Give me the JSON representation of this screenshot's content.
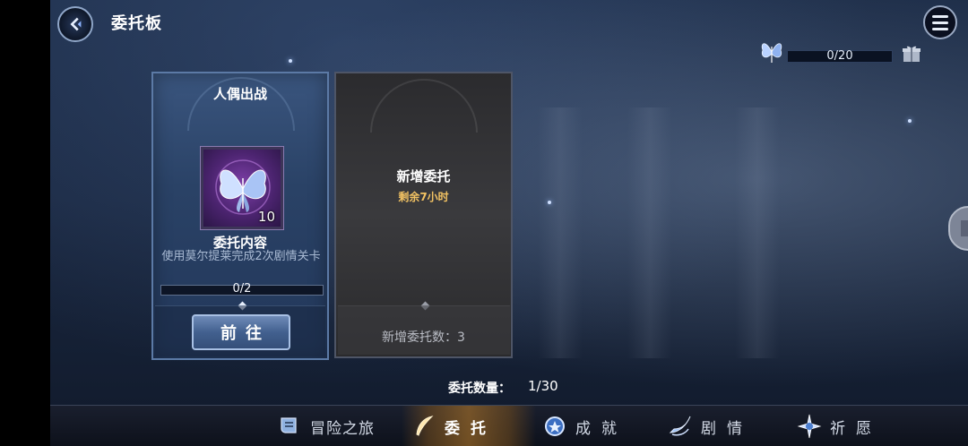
{
  "header": {
    "title": "委托板"
  },
  "topbar": {
    "progress_text": "0/20"
  },
  "cards": [
    {
      "title": "人偶出战",
      "reward_count": "10",
      "content_label": "委托内容",
      "description": "使用莫尔提莱完成2次剧情关卡",
      "progress_text": "0/2",
      "go_label": "前往"
    },
    {
      "title": "新增委托",
      "timer": "剩余7小时",
      "count_text": "新增委托数：3"
    }
  ],
  "footer": {
    "total_label": "委托数量：",
    "total_value": "1/30"
  },
  "nav": {
    "items": [
      {
        "label": "冒险之旅",
        "icon": "scroll-icon"
      },
      {
        "label": "委托",
        "icon": "feather-icon"
      },
      {
        "label": "成就",
        "icon": "medal-icon"
      },
      {
        "label": "剧情",
        "icon": "wing-icon"
      },
      {
        "label": "祈愿",
        "icon": "star-burst-icon"
      }
    ]
  },
  "colors": {
    "accent_gold": "#f3c363",
    "card_blue": "#2a4266",
    "nav_bg": "#0d111b"
  }
}
